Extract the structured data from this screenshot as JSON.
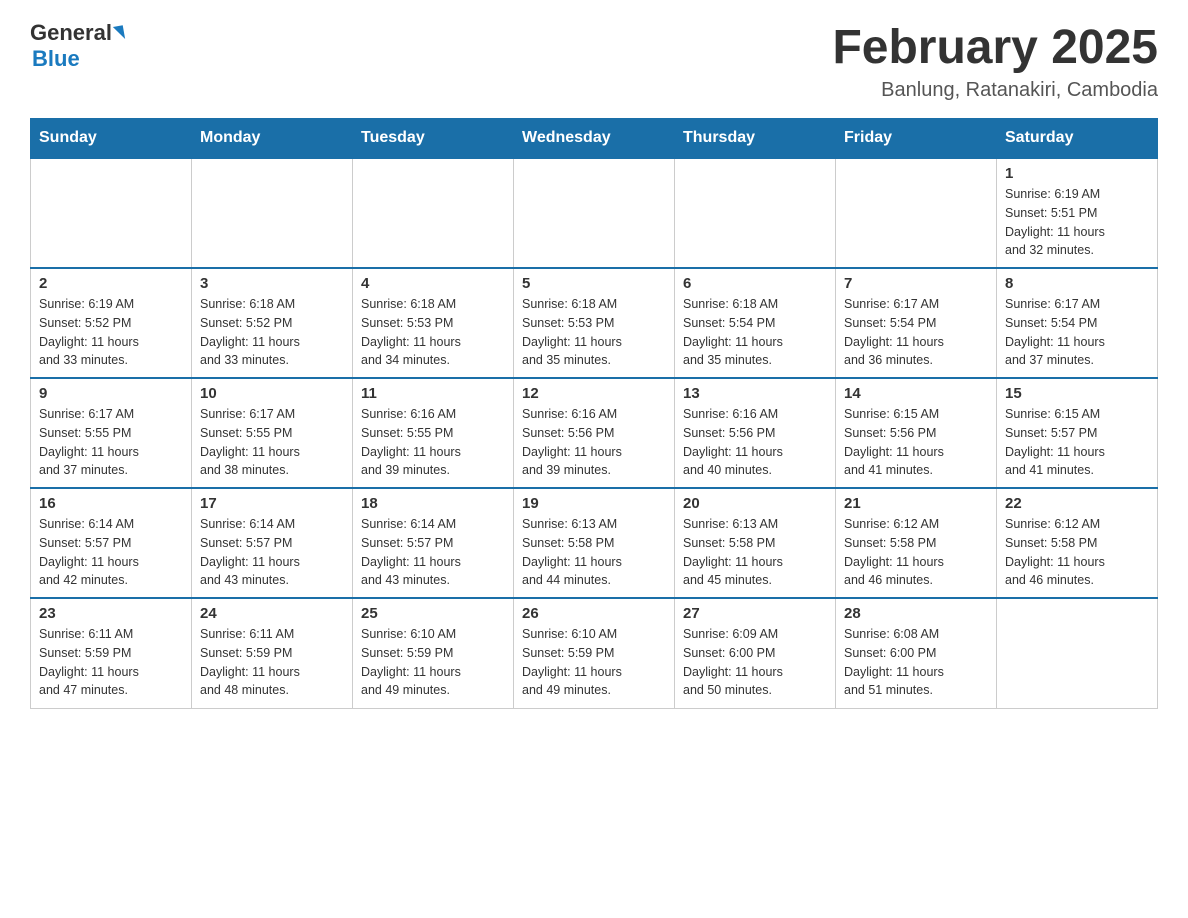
{
  "header": {
    "logo_general": "General",
    "logo_blue": "Blue",
    "month_title": "February 2025",
    "location": "Banlung, Ratanakiri, Cambodia"
  },
  "days_of_week": [
    "Sunday",
    "Monday",
    "Tuesday",
    "Wednesday",
    "Thursday",
    "Friday",
    "Saturday"
  ],
  "weeks": [
    [
      {
        "day": "",
        "info": ""
      },
      {
        "day": "",
        "info": ""
      },
      {
        "day": "",
        "info": ""
      },
      {
        "day": "",
        "info": ""
      },
      {
        "day": "",
        "info": ""
      },
      {
        "day": "",
        "info": ""
      },
      {
        "day": "1",
        "info": "Sunrise: 6:19 AM\nSunset: 5:51 PM\nDaylight: 11 hours\nand 32 minutes."
      }
    ],
    [
      {
        "day": "2",
        "info": "Sunrise: 6:19 AM\nSunset: 5:52 PM\nDaylight: 11 hours\nand 33 minutes."
      },
      {
        "day": "3",
        "info": "Sunrise: 6:18 AM\nSunset: 5:52 PM\nDaylight: 11 hours\nand 33 minutes."
      },
      {
        "day": "4",
        "info": "Sunrise: 6:18 AM\nSunset: 5:53 PM\nDaylight: 11 hours\nand 34 minutes."
      },
      {
        "day": "5",
        "info": "Sunrise: 6:18 AM\nSunset: 5:53 PM\nDaylight: 11 hours\nand 35 minutes."
      },
      {
        "day": "6",
        "info": "Sunrise: 6:18 AM\nSunset: 5:54 PM\nDaylight: 11 hours\nand 35 minutes."
      },
      {
        "day": "7",
        "info": "Sunrise: 6:17 AM\nSunset: 5:54 PM\nDaylight: 11 hours\nand 36 minutes."
      },
      {
        "day": "8",
        "info": "Sunrise: 6:17 AM\nSunset: 5:54 PM\nDaylight: 11 hours\nand 37 minutes."
      }
    ],
    [
      {
        "day": "9",
        "info": "Sunrise: 6:17 AM\nSunset: 5:55 PM\nDaylight: 11 hours\nand 37 minutes."
      },
      {
        "day": "10",
        "info": "Sunrise: 6:17 AM\nSunset: 5:55 PM\nDaylight: 11 hours\nand 38 minutes."
      },
      {
        "day": "11",
        "info": "Sunrise: 6:16 AM\nSunset: 5:55 PM\nDaylight: 11 hours\nand 39 minutes."
      },
      {
        "day": "12",
        "info": "Sunrise: 6:16 AM\nSunset: 5:56 PM\nDaylight: 11 hours\nand 39 minutes."
      },
      {
        "day": "13",
        "info": "Sunrise: 6:16 AM\nSunset: 5:56 PM\nDaylight: 11 hours\nand 40 minutes."
      },
      {
        "day": "14",
        "info": "Sunrise: 6:15 AM\nSunset: 5:56 PM\nDaylight: 11 hours\nand 41 minutes."
      },
      {
        "day": "15",
        "info": "Sunrise: 6:15 AM\nSunset: 5:57 PM\nDaylight: 11 hours\nand 41 minutes."
      }
    ],
    [
      {
        "day": "16",
        "info": "Sunrise: 6:14 AM\nSunset: 5:57 PM\nDaylight: 11 hours\nand 42 minutes."
      },
      {
        "day": "17",
        "info": "Sunrise: 6:14 AM\nSunset: 5:57 PM\nDaylight: 11 hours\nand 43 minutes."
      },
      {
        "day": "18",
        "info": "Sunrise: 6:14 AM\nSunset: 5:57 PM\nDaylight: 11 hours\nand 43 minutes."
      },
      {
        "day": "19",
        "info": "Sunrise: 6:13 AM\nSunset: 5:58 PM\nDaylight: 11 hours\nand 44 minutes."
      },
      {
        "day": "20",
        "info": "Sunrise: 6:13 AM\nSunset: 5:58 PM\nDaylight: 11 hours\nand 45 minutes."
      },
      {
        "day": "21",
        "info": "Sunrise: 6:12 AM\nSunset: 5:58 PM\nDaylight: 11 hours\nand 46 minutes."
      },
      {
        "day": "22",
        "info": "Sunrise: 6:12 AM\nSunset: 5:58 PM\nDaylight: 11 hours\nand 46 minutes."
      }
    ],
    [
      {
        "day": "23",
        "info": "Sunrise: 6:11 AM\nSunset: 5:59 PM\nDaylight: 11 hours\nand 47 minutes."
      },
      {
        "day": "24",
        "info": "Sunrise: 6:11 AM\nSunset: 5:59 PM\nDaylight: 11 hours\nand 48 minutes."
      },
      {
        "day": "25",
        "info": "Sunrise: 6:10 AM\nSunset: 5:59 PM\nDaylight: 11 hours\nand 49 minutes."
      },
      {
        "day": "26",
        "info": "Sunrise: 6:10 AM\nSunset: 5:59 PM\nDaylight: 11 hours\nand 49 minutes."
      },
      {
        "day": "27",
        "info": "Sunrise: 6:09 AM\nSunset: 6:00 PM\nDaylight: 11 hours\nand 50 minutes."
      },
      {
        "day": "28",
        "info": "Sunrise: 6:08 AM\nSunset: 6:00 PM\nDaylight: 11 hours\nand 51 minutes."
      },
      {
        "day": "",
        "info": ""
      }
    ]
  ]
}
